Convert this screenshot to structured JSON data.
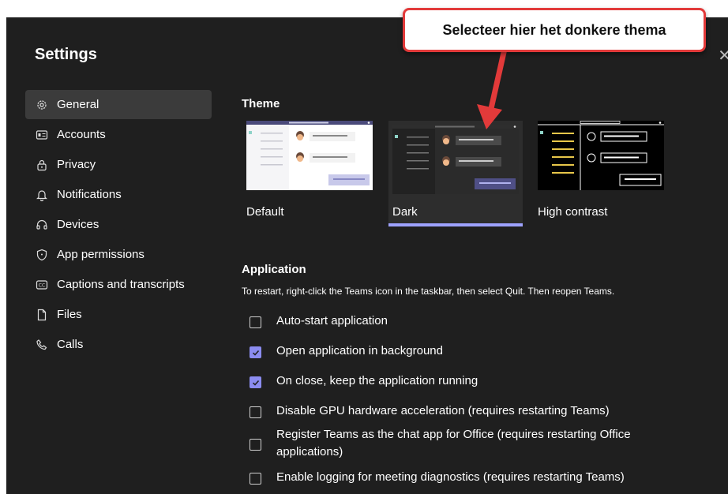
{
  "annotation": {
    "callout_text": "Selecteer hier het donkere thema"
  },
  "window": {
    "title": "Settings",
    "close_glyph": "✕"
  },
  "sidebar": {
    "items": [
      {
        "label": "General",
        "icon": "gear-icon"
      },
      {
        "label": "Accounts",
        "icon": "id-card-icon"
      },
      {
        "label": "Privacy",
        "icon": "lock-icon"
      },
      {
        "label": "Notifications",
        "icon": "bell-icon"
      },
      {
        "label": "Devices",
        "icon": "headset-icon"
      },
      {
        "label": "App permissions",
        "icon": "shield-icon"
      },
      {
        "label": "Captions and transcripts",
        "icon": "cc-icon"
      },
      {
        "label": "Files",
        "icon": "file-icon"
      },
      {
        "label": "Calls",
        "icon": "phone-icon"
      }
    ],
    "active": "General"
  },
  "theme": {
    "heading": "Theme",
    "options": [
      {
        "label": "Default"
      },
      {
        "label": "Dark"
      },
      {
        "label": "High contrast"
      }
    ],
    "selected": "Dark"
  },
  "application": {
    "heading": "Application",
    "description": "To restart, right-click the Teams icon in the taskbar, then select Quit. Then reopen Teams.",
    "options": [
      {
        "label": "Auto-start application",
        "checked": false
      },
      {
        "label": "Open application in background",
        "checked": true
      },
      {
        "label": "On close, keep the application running",
        "checked": true
      },
      {
        "label": "Disable GPU hardware acceleration (requires restarting Teams)",
        "checked": false
      },
      {
        "label": "Register Teams as the chat app for Office (requires restarting Office applications)",
        "checked": false
      },
      {
        "label": "Enable logging for meeting diagnostics (requires restarting Teams)",
        "checked": false
      }
    ]
  },
  "colors": {
    "accent": "#8b8cf0",
    "background": "#1f1f1f",
    "callout_border": "#e23a3a"
  }
}
